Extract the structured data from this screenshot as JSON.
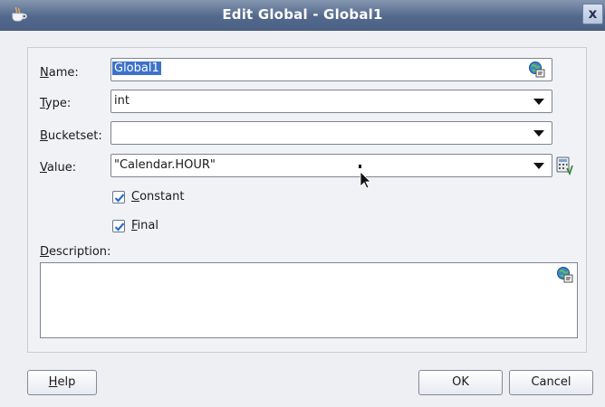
{
  "window": {
    "title": "Edit Global - Global1",
    "close_label": "x",
    "app_icon": "java-cup-icon"
  },
  "form": {
    "name": {
      "label": "Name:",
      "mnemonic": "N",
      "label_rest": "ame:",
      "value": "Global1",
      "icon": "globe-translate-icon"
    },
    "type": {
      "label": "Type:",
      "mnemonic": "T",
      "label_rest": "ype:",
      "value": "int"
    },
    "bucketset": {
      "label": "Bucketset:",
      "mnemonic": "B",
      "label_rest": "ucketset:",
      "value": ""
    },
    "value": {
      "label": "Value:",
      "mnemonic": "V",
      "label_rest": "alue:",
      "value": "\"Calendar.HOUR\"",
      "icon": "expression-builder-icon"
    },
    "constant": {
      "label": "Constant",
      "mnemonic": "C",
      "label_rest": "onstant",
      "checked": true
    },
    "final": {
      "label": "Final",
      "mnemonic": "F",
      "label_rest": "inal",
      "checked": true
    },
    "description": {
      "label": "Description:",
      "mnemonic": "D",
      "label_rest": "escription:",
      "value": "",
      "icon": "globe-translate-icon"
    }
  },
  "buttons": {
    "help": {
      "label": "Help",
      "mnemonic": "H",
      "label_rest": "elp"
    },
    "ok": {
      "label": "OK"
    },
    "cancel": {
      "label": "Cancel"
    }
  },
  "colors": {
    "titlebar": "#53698c",
    "selection": "#3d72c8",
    "checkmark": "#2a6bd1"
  }
}
